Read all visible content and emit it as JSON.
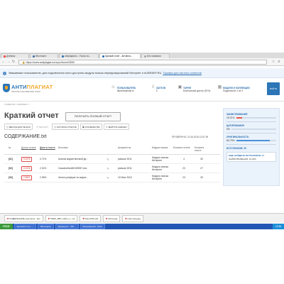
{
  "browser": {
    "tabs": [
      {
        "label": "Дневник"
      },
      {
        "label": "ВКонтакте"
      },
      {
        "label": "antiplagiat.ru - Поиск по..."
      },
      {
        "label": "Краткий отчет - Антипла...",
        "active": true
      },
      {
        "label": "Без названия"
      }
    ],
    "url": "https://www.antiplagiat.ru/report/short/3559"
  },
  "notice": {
    "text": "Уважаемые пользователи, для подключения этого доступны модули поиска перефразирований Интернет и eLIBRARY.RU.",
    "link": "Тарифы для частных клиентов"
  },
  "header": {
    "logo_main": "АНТИ",
    "logo_accent": "ПЛАГИАТ",
    "logo_sub": "ТВОРИТЕ СОБСТВЕННЫМ УМОМ",
    "user_label": "ПОЛЬЗОВАТЕЛЬ",
    "user_value": "libpress@mail.ru",
    "downloads_label": "ЗАГЛОВ",
    "downloads_value": "0",
    "tariff_label": "ТАРИФ",
    "tariff_value": "Бесплатный доступ (91%)",
    "modules_label": "МОДУЛИ И КОЛЛЕКЦИИ",
    "modules_value": "Подключено 1 из 3",
    "side_button": "ВОЙТИ"
  },
  "breadcrumb": "ГЛАВНАЯ / КАБИНЕТ /",
  "page_title": "Краткий отчет",
  "get_full_report": "ПОЛУЧИТЬ ПОЛНЫЙ ОТЧЕТ",
  "toolbar": [
    {
      "label": "ВЕРСИЯ ДЛЯ ПЕЧАТИ",
      "icon": "print-icon"
    },
    {
      "label": "ЭКСПОРТ",
      "icon": "export-icon"
    },
    {
      "label": "ИСТОРИЯ ОТЧЕТОВ",
      "icon": "history-icon"
    },
    {
      "label": "РУКОВОДСТВО",
      "icon": "book-icon"
    },
    {
      "label": "ВЫЙТИ В КАБИНЕТ",
      "icon": "exit-icon"
    }
  ],
  "document_name": "СОДЕРЖАНИЕ.txt",
  "checked": "ПРОВЕРЕНО:  21.06.2018 12:57:39",
  "table": {
    "headers": [
      "№",
      "Доля в отчете",
      "Доля в тексте",
      "Источник",
      "Актуален на",
      "Модуль поиска",
      "Блоков в отчете",
      "Блоков в тексте"
    ],
    "rows": [
      {
        "n": "[01]",
        "share_report": "9.10%",
        "share_text": "0.71%",
        "source": "Анализ маркетинговой де...",
        "date": "раньше 2011",
        "module": "Модуль поиска Интернет",
        "blocks_report": "4",
        "blocks_text": "30"
      },
      {
        "n": "[02]",
        "share_report": "2.31%",
        "share_text": "2.31%",
        "source": "Скачать/bank9/183067.doc",
        "date": "раньше 2011",
        "module": "Модуль поиска Интернет",
        "blocks_report": "23",
        "blocks_text": "27"
      },
      {
        "n": "[03]",
        "share_report": "2.35%",
        "share_text": "2.35%",
        "source": "Читать реферат по марке...",
        "date": "15 Июл 2016",
        "module": "Модуль поиска Интернет",
        "blocks_report": "23",
        "blocks_text": "25"
      }
    ]
  },
  "panel": {
    "borrow_label": "ЗАИМСТВОВАНИЯ",
    "borrow_value": "15.21%",
    "borrow_fraction": 0.1521,
    "cite_label": "ЦИТИРОВАНИЯ",
    "cite_value": "0%",
    "cite_fraction": 0.0,
    "orig_label": "ОРИГИНАЛЬНОСТЬ",
    "orig_value": "84.79%",
    "orig_fraction": 0.8479,
    "sources_label": "ИСТОЧНИКОВ: 20",
    "found_label": "ЕЩЕ НАЙДЕНО ИСТОЧНИКОВ: 17",
    "found_value": "ЗАИМСТВОВАНИЯ: 16.24%",
    "colors": {
      "borrow": "#e8564a",
      "orig": "#4a90d9"
    }
  },
  "downloads": [
    {
      "label": "СОДЕРЖАНИЕ_Контроль...doc"
    },
    {
      "label": "ТЕМА_ВКР_сайты_с...txt"
    },
    {
      "label": "КАН-2015.pdf"
    },
    {
      "label": "actrus.jpg"
    },
    {
      "label": "mail-ruspy.jpg"
    }
  ],
  "taskbar": {
    "start": "ПУСК",
    "items": [
      {
        "label": "Краткий отчет -..."
      },
      {
        "label": "ВКонтакте"
      },
      {
        "label": "Документ1 - Mic..."
      },
      {
        "label": "Безымянный - Paint"
      }
    ],
    "clock": "12:58"
  }
}
